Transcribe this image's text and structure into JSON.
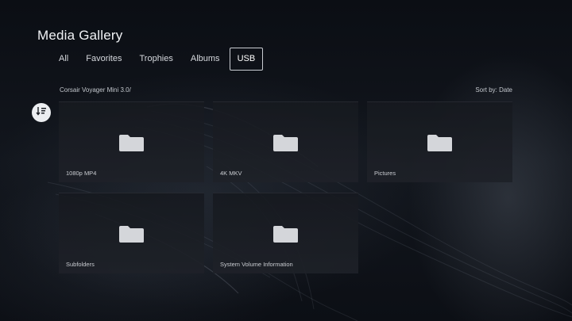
{
  "header": {
    "title": "Media Gallery"
  },
  "tabs": [
    {
      "label": "All",
      "active": false
    },
    {
      "label": "Favorites",
      "active": false
    },
    {
      "label": "Trophies",
      "active": false
    },
    {
      "label": "Albums",
      "active": false
    },
    {
      "label": "USB",
      "active": true
    }
  ],
  "location": {
    "path": "Corsair Voyager Mini 3.0/"
  },
  "sort": {
    "label": "Sort by: Date",
    "icon": "sort-order-icon"
  },
  "folders": [
    {
      "name": "1080p MP4",
      "icon": "folder-icon"
    },
    {
      "name": "4K MKV",
      "icon": "folder-icon"
    },
    {
      "name": "Pictures",
      "icon": "folder-icon"
    },
    {
      "name": "Subfolders",
      "icon": "folder-icon"
    },
    {
      "name": "System Volume Information",
      "icon": "folder-icon"
    }
  ],
  "colors": {
    "background": "#0d1016",
    "text": "#e8eaee",
    "folder": "#d4d6da",
    "active_tab_border": "#c9ccd2"
  }
}
